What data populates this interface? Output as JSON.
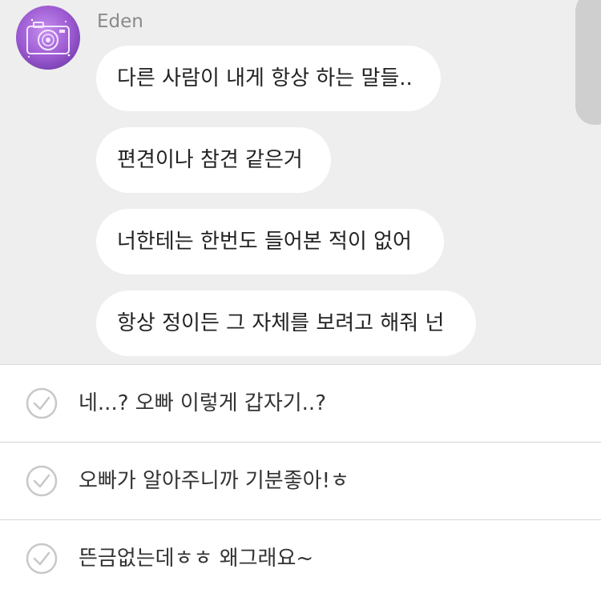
{
  "chat": {
    "sender_name": "Eden",
    "messages": [
      "다른 사람이 내게 항상 하는 말들..",
      "편견이나 참견 같은거",
      "너한테는 한번도 들어본 적이 없어",
      "항상 정이든 그 자체를 보려고 해줘 넌"
    ]
  },
  "reply_options": [
    {
      "text": "네...? 오빠 이렇게 갑자기..?",
      "icon": "check-circle-icon"
    },
    {
      "text": "오빠가 알아주니까 기분좋아!ㅎ",
      "icon": "check-circle-icon"
    },
    {
      "text": "뜬금없는데ㅎㅎ 왜그래요~",
      "icon": "check-circle-icon"
    }
  ],
  "colors": {
    "chat_background": "#eeeeee",
    "bubble": "#ffffff",
    "avatar_accent": "#9b59d0",
    "check_icon": "#c8c8c8"
  }
}
